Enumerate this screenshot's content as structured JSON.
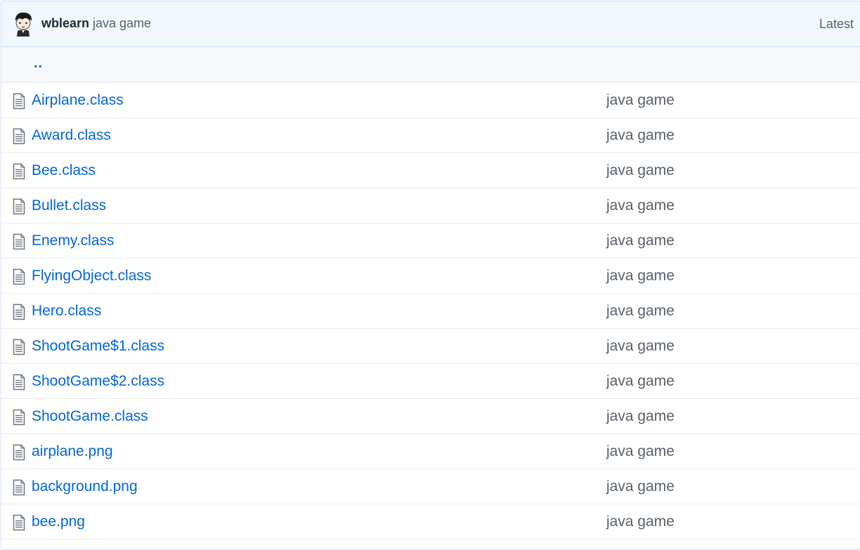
{
  "commit": {
    "author": "wblearn",
    "message": "java game",
    "latest_label": "Latest"
  },
  "parent_dir_label": "..",
  "files": [
    {
      "name": "Airplane.class",
      "message": "java game",
      "icon": "file-icon"
    },
    {
      "name": "Award.class",
      "message": "java game",
      "icon": "file-icon"
    },
    {
      "name": "Bee.class",
      "message": "java game",
      "icon": "file-icon"
    },
    {
      "name": "Bullet.class",
      "message": "java game",
      "icon": "file-icon"
    },
    {
      "name": "Enemy.class",
      "message": "java game",
      "icon": "file-icon"
    },
    {
      "name": "FlyingObject.class",
      "message": "java game",
      "icon": "file-icon"
    },
    {
      "name": "Hero.class",
      "message": "java game",
      "icon": "file-icon"
    },
    {
      "name": "ShootGame$1.class",
      "message": "java game",
      "icon": "file-icon"
    },
    {
      "name": "ShootGame$2.class",
      "message": "java game",
      "icon": "file-icon"
    },
    {
      "name": "ShootGame.class",
      "message": "java game",
      "icon": "file-icon"
    },
    {
      "name": "airplane.png",
      "message": "java game",
      "icon": "file-icon"
    },
    {
      "name": "background.png",
      "message": "java game",
      "icon": "file-icon"
    },
    {
      "name": "bee.png",
      "message": "java game",
      "icon": "file-icon"
    }
  ],
  "colors": {
    "link": "#0366d6",
    "muted": "#586069",
    "commit_bar_bg": "#f1f8ff",
    "commit_bar_border": "#c8e1ff"
  }
}
